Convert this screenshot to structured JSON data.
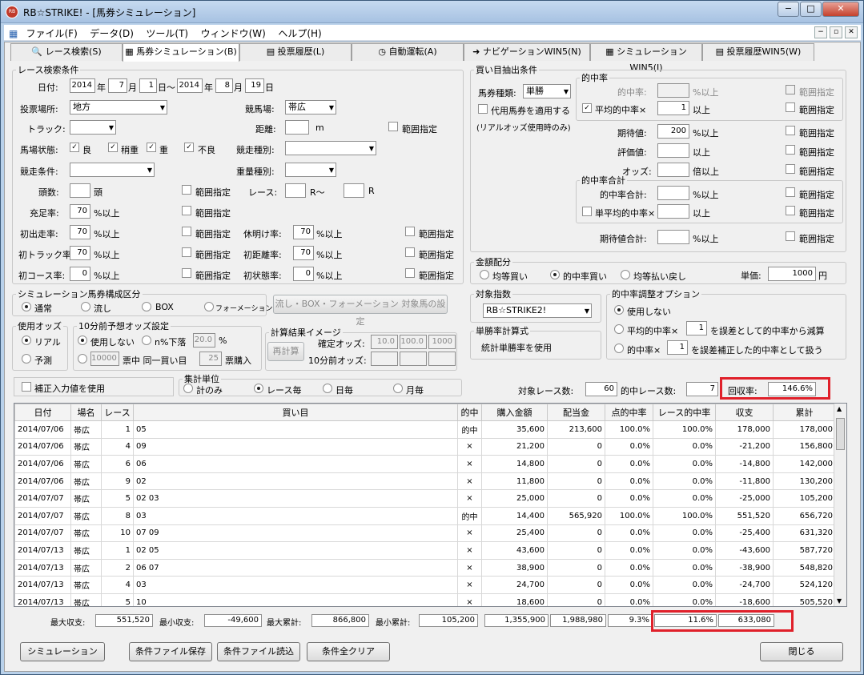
{
  "title": "RB☆STRIKE! - [馬券シミュレーション]",
  "app_icon": "RB",
  "window_buttons": {
    "min": "−",
    "max": "□",
    "close": "✕"
  },
  "mdi_buttons": {
    "min": "−",
    "restore": "▫",
    "close": "✕"
  },
  "menu": [
    "ファイル(F)",
    "データ(D)",
    "ツール(T)",
    "ウィンドウ(W)",
    "ヘルプ(H)"
  ],
  "tabs": [
    "レース検索(S)",
    "馬券シミュレーション(B)",
    "投票履歴(L)",
    "自動運転(A)",
    "ナビゲーションWIN5(N)",
    "シミュレーションWIN5(I)",
    "投票履歴WIN5(W)"
  ],
  "race": {
    "legend": "レース検索条件",
    "date_label": "日付:",
    "y1": "2014",
    "m1": "7",
    "d1": "1",
    "y2": "2014",
    "m2": "8",
    "d2": "19",
    "u_year": "年",
    "u_month": "月",
    "u_day_from": "日〜",
    "u_day": "日",
    "venue_label": "投票場所:",
    "venue": "地方",
    "course_label": "競馬場:",
    "course": "帯広",
    "track_label": "トラック:",
    "dist_label": "距離:",
    "dist_unit": "m",
    "range": "範囲指定",
    "cond_label": "馬場状態:",
    "cond": [
      "良",
      "稍重",
      "重",
      "不良"
    ],
    "racetype_label": "競走種別:",
    "racecond_label": "競走条件:",
    "weight_label": "重量種別:",
    "heads_label": "頭数:",
    "heads_unit": "頭",
    "race_label": "レース:",
    "race_from": "R〜",
    "race_to": "R",
    "fill_label": "充足率:",
    "fill": "70",
    "pct_over": "%以上",
    "first_label": "初出走率:",
    "first": "70",
    "rest_label": "休明け率:",
    "rest": "70",
    "ftrack_label": "初トラック率:",
    "ftrack": "70",
    "fdist_label": "初距離率:",
    "fdist": "70",
    "fcourse_label": "初コース率:",
    "fcourse": "0",
    "fstate_label": "初状態率:",
    "fstate": "0"
  },
  "sim": {
    "legend": "シミュレーション馬券構成区分",
    "opts": [
      "通常",
      "流し",
      "BOX",
      "フォーメーション"
    ],
    "btn": "流し・BOX・フォーメーション 対象馬の設定"
  },
  "odds": {
    "legend": "使用オッズ",
    "opts": [
      "リアル",
      "予測"
    ]
  },
  "pre": {
    "legend": "10分前予想オッズ設定",
    "no": "使用しない",
    "n_label": "n%下落",
    "n_val": "20.0",
    "pct": "%",
    "v1": "10000",
    "t1": "票中 同一買い目",
    "v2": "25",
    "t2": "票購入"
  },
  "calc": {
    "legend": "計算結果イメージ",
    "btn": "再計算",
    "fixed_label": "確定オッズ:",
    "f": [
      "10.0",
      "100.0",
      "1000"
    ],
    "pre_label": "10分前オッズ:"
  },
  "fix": "補正入力値を使用",
  "agg": {
    "legend": "集計単位",
    "opts": [
      "計のみ",
      "レース毎",
      "日毎",
      "月毎"
    ]
  },
  "buy": {
    "legend": "買い目抽出条件",
    "type_label": "馬券種類:",
    "type": "単勝",
    "substitute": "代用馬券を適用する",
    "sub_note": "(リアルオッズ使用時のみ)",
    "hit_legend": "的中率",
    "hit_label": "的中率:",
    "avg_label": "平均的中率×",
    "avg": "1",
    "over": "以上",
    "range": "範囲指定",
    "exp_label": "期待値:",
    "exp": "200",
    "eval_label": "評価値:",
    "odds_label": "オッズ:",
    "odds_unit": "倍以上",
    "sum_legend": "的中率合計",
    "sum_label": "的中率合計:",
    "savg_label": "単平均的中率×",
    "expsum_label": "期待値合計:"
  },
  "alloc": {
    "legend": "金額配分",
    "opts": [
      "均等買い",
      "的中率買い",
      "均等払い戻し"
    ],
    "unit_label": "単価:",
    "unit": "1000",
    "yen": "円"
  },
  "index": {
    "legend": "対象指数",
    "value": "RB☆STRIKE2!"
  },
  "win": {
    "legend": "単勝率計算式",
    "text": "統計単勝率を使用"
  },
  "adj": {
    "legend": "的中率調整オプション",
    "opts": [
      "使用しない",
      "平均的中率×",
      "的中率×"
    ],
    "v1": "1",
    "t1": "を誤差として的中率から減算",
    "v2": "1",
    "t2": "を誤差補正した的中率として扱う"
  },
  "summary": {
    "races_label": "対象レース数:",
    "races": "60",
    "hits_label": "的中レース数:",
    "hits": "7",
    "roi_label": "回収率:",
    "roi": "146.6%"
  },
  "headers": [
    "日付",
    "場名",
    "レース",
    "買い目",
    "的中",
    "購入金額",
    "配当金",
    "点的中率",
    "レース的中率",
    "収支",
    "累計"
  ],
  "rows": [
    [
      "2014/07/06",
      "帯広",
      "1",
      "05",
      "的中",
      "35,600",
      "213,600",
      "100.0%",
      "100.0%",
      "178,000",
      "178,000"
    ],
    [
      "2014/07/06",
      "帯広",
      "4",
      "09",
      "×",
      "21,200",
      "0",
      "0.0%",
      "0.0%",
      "-21,200",
      "156,800"
    ],
    [
      "2014/07/06",
      "帯広",
      "6",
      "06",
      "×",
      "14,800",
      "0",
      "0.0%",
      "0.0%",
      "-14,800",
      "142,000"
    ],
    [
      "2014/07/06",
      "帯広",
      "9",
      "02",
      "×",
      "11,800",
      "0",
      "0.0%",
      "0.0%",
      "-11,800",
      "130,200"
    ],
    [
      "2014/07/07",
      "帯広",
      "5",
      "02 03",
      "×",
      "25,000",
      "0",
      "0.0%",
      "0.0%",
      "-25,000",
      "105,200"
    ],
    [
      "2014/07/07",
      "帯広",
      "8",
      "03",
      "的中",
      "14,400",
      "565,920",
      "100.0%",
      "100.0%",
      "551,520",
      "656,720"
    ],
    [
      "2014/07/07",
      "帯広",
      "10",
      "07 09",
      "×",
      "25,400",
      "0",
      "0.0%",
      "0.0%",
      "-25,400",
      "631,320"
    ],
    [
      "2014/07/13",
      "帯広",
      "1",
      "02 05",
      "×",
      "43,600",
      "0",
      "0.0%",
      "0.0%",
      "-43,600",
      "587,720"
    ],
    [
      "2014/07/13",
      "帯広",
      "2",
      "06 07",
      "×",
      "38,900",
      "0",
      "0.0%",
      "0.0%",
      "-38,900",
      "548,820"
    ],
    [
      "2014/07/13",
      "帯広",
      "4",
      "03",
      "×",
      "24,700",
      "0",
      "0.0%",
      "0.0%",
      "-24,700",
      "524,120"
    ],
    [
      "2014/07/13",
      "帯広",
      "5",
      "10",
      "×",
      "18,600",
      "0",
      "0.0%",
      "0.0%",
      "-18,600",
      "505,520"
    ]
  ],
  "totals": {
    "max_label": "最大収支:",
    "max": "551,520",
    "min_label": "最小収支:",
    "min": "-49,600",
    "maxc_label": "最大累計:",
    "maxc": "866,800",
    "minc_label": "最小累計:",
    "minc": "105,200",
    "buy": "1,355,900",
    "pay": "1,988,980",
    "pt": "9.3%",
    "race": "11.6%",
    "bal": "633,080"
  },
  "buttons": {
    "simulate": "シミュレーション",
    "save": "条件ファイル保存",
    "load": "条件ファイル読込",
    "clear": "条件全クリア",
    "close": "閉じる"
  },
  "colors": {
    "highlight": "#e0202a"
  }
}
